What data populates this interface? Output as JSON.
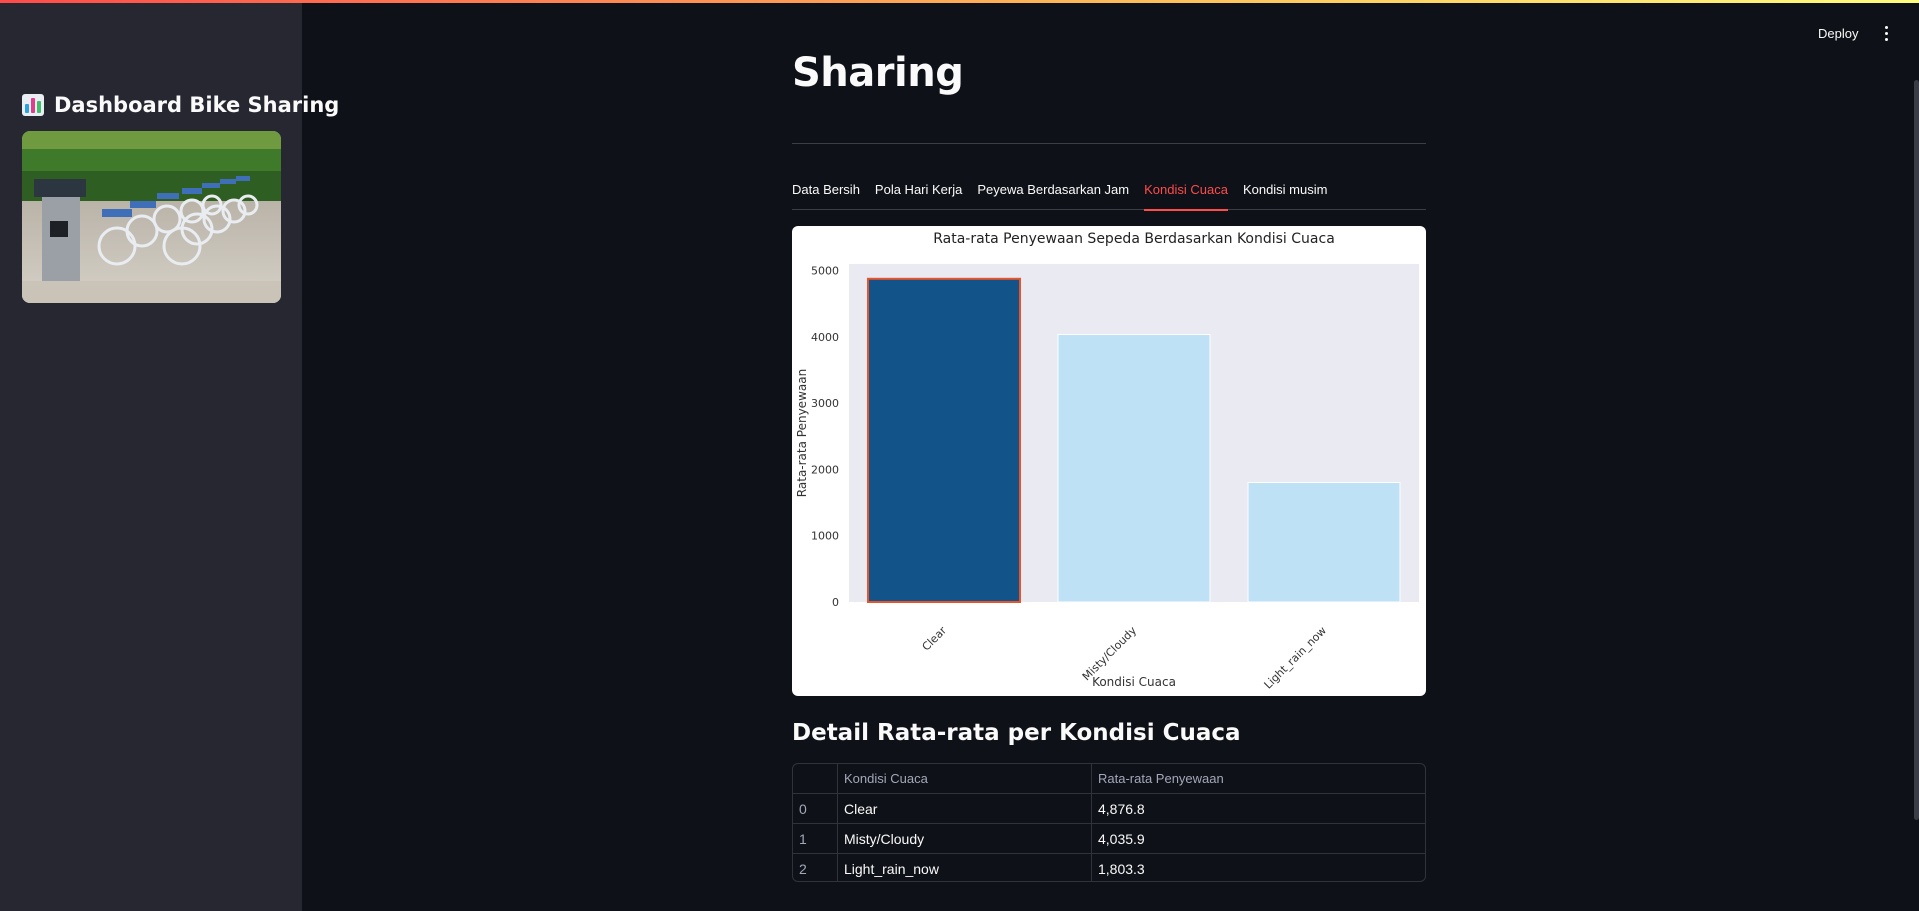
{
  "app": {
    "deploy_label": "Deploy"
  },
  "sidebar": {
    "title": "Dashboard Bike Sharing"
  },
  "main": {
    "title": "Sharing",
    "tabs": [
      {
        "label": "Data Bersih",
        "active": false
      },
      {
        "label": "Pola Hari Kerja",
        "active": false
      },
      {
        "label": "Peyewa Berdasarkan Jam",
        "active": false
      },
      {
        "label": "Kondisi Cuaca",
        "active": true
      },
      {
        "label": "Kondisi musim",
        "active": false
      }
    ],
    "section_title": "Detail Rata-rata per Kondisi Cuaca",
    "table": {
      "headers": [
        "",
        "Kondisi Cuaca",
        "Rata-rata Penyewaan"
      ],
      "rows": [
        [
          "0",
          "Clear",
          "4,876.8"
        ],
        [
          "1",
          "Misty/Cloudy",
          "4,035.9"
        ],
        [
          "2",
          "Light_rain_now",
          "1,803.3"
        ]
      ]
    }
  },
  "chart_data": {
    "type": "bar",
    "title": "Rata-rata Penyewaan Sepeda Berdasarkan Kondisi Cuaca",
    "xlabel": "Kondisi Cuaca",
    "ylabel": "Rata-rata Penyewaan",
    "categories": [
      "Clear",
      "Misty/Cloudy",
      "Light_rain_now"
    ],
    "values": [
      4876.8,
      4035.9,
      1803.3
    ],
    "ylim": [
      0,
      5100
    ],
    "yticks": [
      0,
      1000,
      2000,
      3000,
      4000,
      5000
    ],
    "colors": [
      "#12548a",
      "#bfe1f5",
      "#bfe1f5"
    ],
    "highlight_edge": "#e8542a",
    "plot_background": "#eaeaf2",
    "grid": false
  },
  "colors": {
    "accent": "#ff4b4b",
    "background": "#0e1117",
    "sidebar": "#262730"
  }
}
